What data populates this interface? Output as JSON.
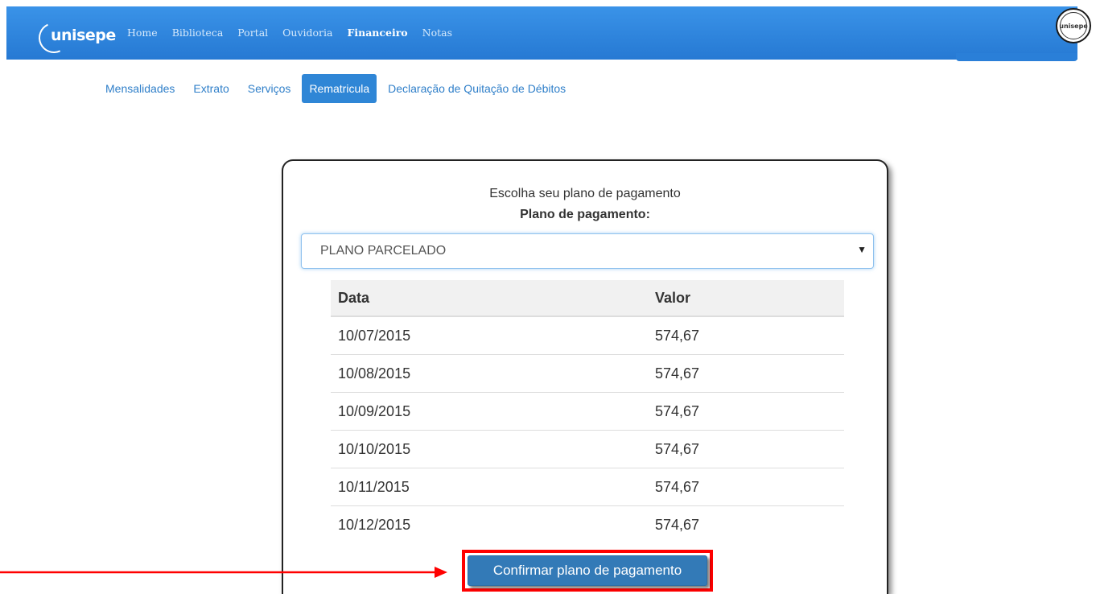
{
  "header": {
    "logo_text": "unisepe",
    "nav": [
      {
        "label": "Home",
        "active": false
      },
      {
        "label": "Biblioteca",
        "active": false
      },
      {
        "label": "Portal",
        "active": false
      },
      {
        "label": "Ouvidoria",
        "active": false
      },
      {
        "label": "Financeiro",
        "active": true
      },
      {
        "label": "Notas",
        "active": false
      }
    ],
    "avatar_text": "unisepe"
  },
  "subnav": [
    {
      "label": "Mensalidades",
      "active": false
    },
    {
      "label": "Extrato",
      "active": false
    },
    {
      "label": "Serviços",
      "active": false
    },
    {
      "label": "Rematricula",
      "active": true
    },
    {
      "label": "Declaração de Quitação de Débitos",
      "active": false
    }
  ],
  "plan": {
    "title": "Escolha seu plano de pagamento",
    "label": "Plano de pagamento:",
    "selected": "PLANO PARCELADO",
    "columns": [
      "Data",
      "Valor"
    ],
    "rows": [
      [
        "10/07/2015",
        "574,67"
      ],
      [
        "10/08/2015",
        "574,67"
      ],
      [
        "10/09/2015",
        "574,67"
      ],
      [
        "10/10/2015",
        "574,67"
      ],
      [
        "10/11/2015",
        "574,67"
      ],
      [
        "10/12/2015",
        "574,67"
      ]
    ],
    "confirm_label": "Confirmar plano de pagamento"
  },
  "colors": {
    "header": "#2a7fd8",
    "primary_button": "#337ab7",
    "annotation": "#ff0000",
    "link": "#2f7fc9"
  }
}
